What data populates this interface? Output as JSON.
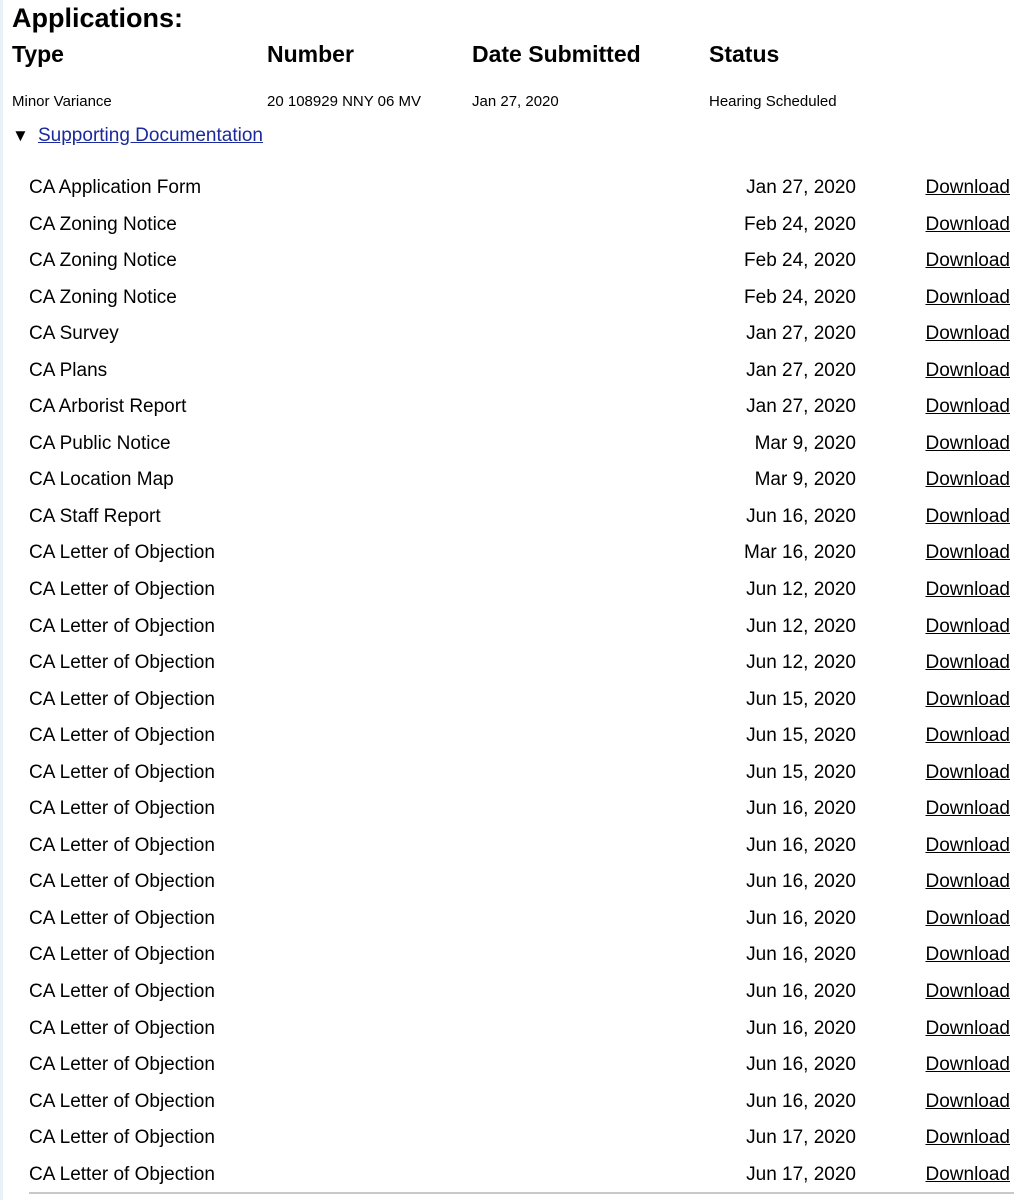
{
  "page": {
    "title": "Applications:"
  },
  "applications": {
    "headers": {
      "type": "Type",
      "number": "Number",
      "date_submitted": "Date Submitted",
      "status": "Status"
    },
    "rows": [
      {
        "type": "Minor Variance",
        "number": "20 108929 NNY 06 MV",
        "date_submitted": "Jan 27, 2020",
        "status": "Hearing Scheduled"
      }
    ]
  },
  "supporting_documentation": {
    "toggle_icon": "▼",
    "toggle_label": "Supporting Documentation",
    "expanded": true,
    "download_label": "Download",
    "documents": [
      {
        "name": "CA Application Form",
        "date": "Jan 27, 2020"
      },
      {
        "name": "CA Zoning Notice",
        "date": "Feb 24, 2020"
      },
      {
        "name": "CA Zoning Notice",
        "date": "Feb 24, 2020"
      },
      {
        "name": "CA Zoning Notice",
        "date": "Feb 24, 2020"
      },
      {
        "name": "CA Survey",
        "date": "Jan 27, 2020"
      },
      {
        "name": "CA Plans",
        "date": "Jan 27, 2020"
      },
      {
        "name": "CA Arborist Report",
        "date": "Jan 27, 2020"
      },
      {
        "name": "CA Public Notice",
        "date": "Mar 9, 2020"
      },
      {
        "name": "CA Location Map",
        "date": "Mar 9, 2020"
      },
      {
        "name": "CA Staff Report",
        "date": "Jun 16, 2020"
      },
      {
        "name": "CA Letter of Objection",
        "date": "Mar 16, 2020"
      },
      {
        "name": "CA Letter of Objection",
        "date": "Jun 12, 2020"
      },
      {
        "name": "CA Letter of Objection",
        "date": "Jun 12, 2020"
      },
      {
        "name": "CA Letter of Objection",
        "date": "Jun 12, 2020"
      },
      {
        "name": "CA Letter of Objection",
        "date": "Jun 15, 2020"
      },
      {
        "name": "CA Letter of Objection",
        "date": "Jun 15, 2020"
      },
      {
        "name": "CA Letter of Objection",
        "date": "Jun 15, 2020"
      },
      {
        "name": "CA Letter of Objection",
        "date": "Jun 16, 2020"
      },
      {
        "name": "CA Letter of Objection",
        "date": "Jun 16, 2020"
      },
      {
        "name": "CA Letter of Objection",
        "date": "Jun 16, 2020"
      },
      {
        "name": "CA Letter of Objection",
        "date": "Jun 16, 2020"
      },
      {
        "name": "CA Letter of Objection",
        "date": "Jun 16, 2020"
      },
      {
        "name": "CA Letter of Objection",
        "date": "Jun 16, 2020"
      },
      {
        "name": "CA Letter of Objection",
        "date": "Jun 16, 2020"
      },
      {
        "name": "CA Letter of Objection",
        "date": "Jun 16, 2020"
      },
      {
        "name": "CA Letter of Objection",
        "date": "Jun 16, 2020"
      },
      {
        "name": "CA Letter of Objection",
        "date": "Jun 17, 2020"
      },
      {
        "name": "CA Letter of Objection",
        "date": "Jun 17, 2020"
      }
    ]
  },
  "colors": {
    "link": "#1a2a9a",
    "text": "#000000",
    "rule": "#c8c8c8"
  }
}
